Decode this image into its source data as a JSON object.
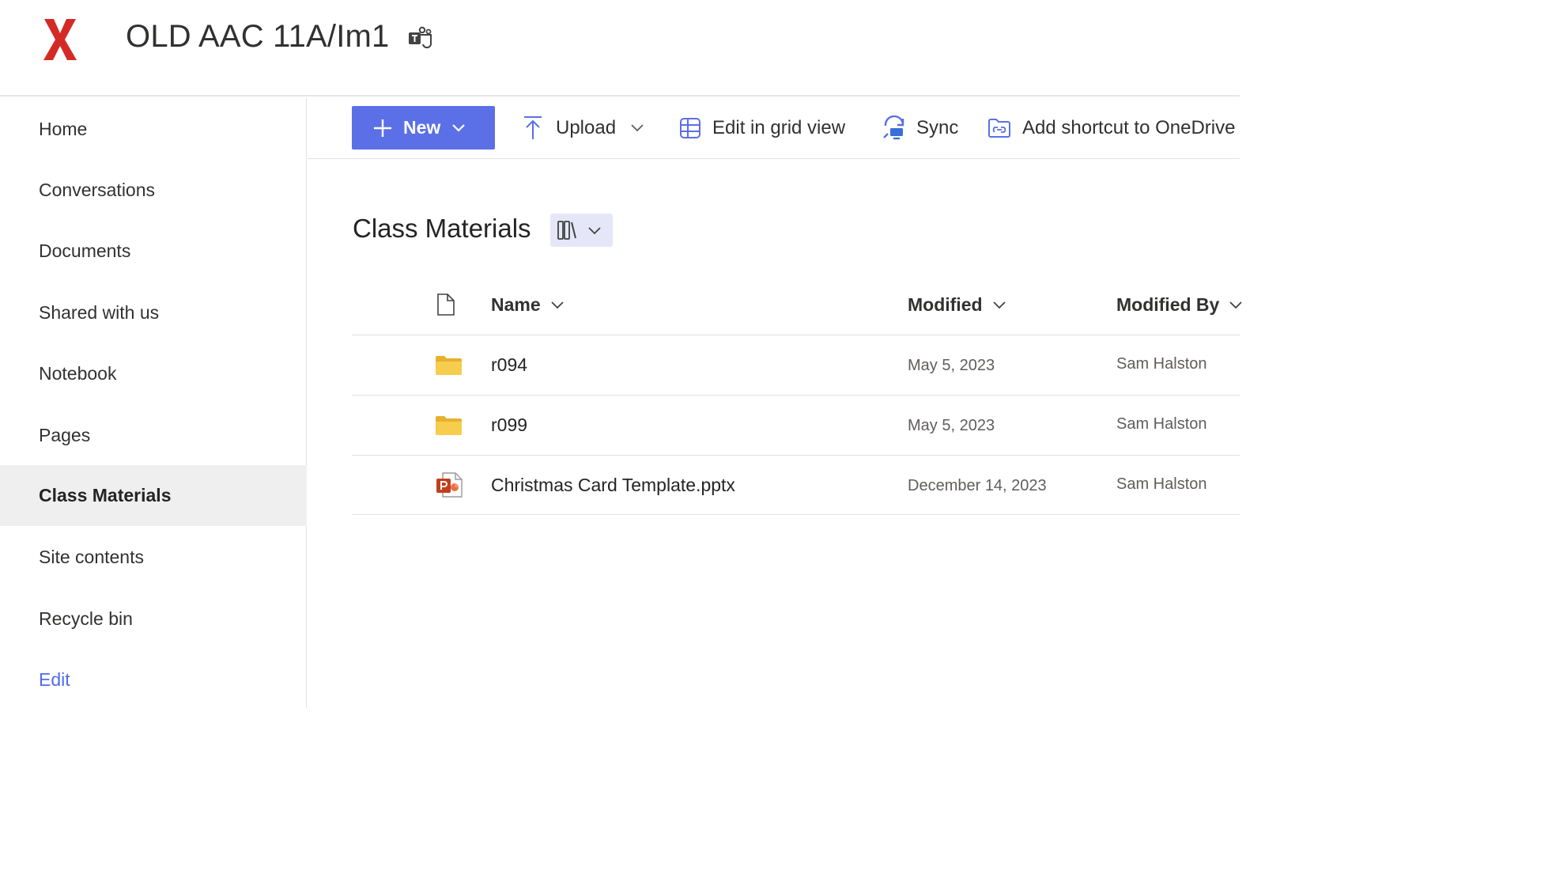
{
  "header": {
    "logo_letter": "X",
    "site_title": "OLD AAC 11A/Im1",
    "teams_icon": "teams-icon"
  },
  "colors": {
    "accent": "#5b6fe6",
    "logo_red": "#d42a26",
    "folder_yellow": "#f2c94c",
    "ppt_red": "#c43e1c"
  },
  "sidebar": {
    "items": [
      {
        "label": "Home"
      },
      {
        "label": "Conversations"
      },
      {
        "label": "Documents"
      },
      {
        "label": "Shared with us"
      },
      {
        "label": "Notebook"
      },
      {
        "label": "Pages"
      },
      {
        "label": "Class Materials",
        "active": true
      },
      {
        "label": "Site contents"
      },
      {
        "label": "Recycle bin"
      }
    ],
    "edit_label": "Edit"
  },
  "toolbar": {
    "new_label": "New",
    "upload_label": "Upload",
    "grid_label": "Edit in grid view",
    "sync_label": "Sync",
    "shortcut_label": "Add shortcut to OneDrive"
  },
  "library": {
    "title": "Class Materials",
    "view_icon": "library-view-icon"
  },
  "table": {
    "columns": {
      "type_icon": "file-type-icon",
      "name": "Name",
      "modified": "Modified",
      "modified_by": "Modified By"
    },
    "rows": [
      {
        "icon": "folder-icon",
        "name": "r094",
        "modified": "May 5, 2023",
        "modified_by": "Sam Halston"
      },
      {
        "icon": "folder-icon",
        "name": "r099",
        "modified": "May 5, 2023",
        "modified_by": "Sam Halston"
      },
      {
        "icon": "powerpoint-icon",
        "name": "Christmas Card Template.pptx",
        "modified": "December 14, 2023",
        "modified_by": "Sam Halston"
      }
    ]
  }
}
